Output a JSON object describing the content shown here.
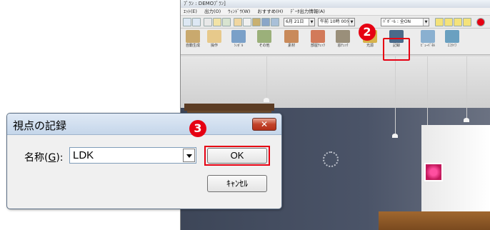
{
  "app": {
    "title": "ﾌﾟﾗﾝ : DEMOﾌﾟﾗﾝ]",
    "menu": [
      "ｴｯﾄ(E)",
      "出力(O)",
      "ｳｨﾝﾄﾞｳ(W)",
      "おすすめ(H)",
      "ﾃﾞｰﾀ出力情報(A)"
    ],
    "date_combo": "6月 21日",
    "time_combo": "午前 10時 00分",
    "view_combo": "ﾊﾟﾎﾞｰﾙ : 全ON",
    "tools": [
      {
        "label": "自動生成",
        "color": "#c9a96e"
      },
      {
        "label": "操作",
        "color": "#e7c98b"
      },
      {
        "label": "ｼﾝﾎﾞﾙ",
        "color": "#7aa0c8"
      },
      {
        "label": "その他",
        "color": "#9bb07a"
      },
      {
        "label": "素材",
        "color": "#c98a5a"
      },
      {
        "label": "部屋ﾁｪｯｸ",
        "color": "#d27a5a"
      },
      {
        "label": "窓ﾁｪｯｸ",
        "color": "#9a8f7a"
      },
      {
        "label": "光源",
        "color": "#d7b34a"
      },
      {
        "label": "記録",
        "color": "#4a6a8a"
      },
      {
        "label": "ﾋﾞｭｰﾊﾟﾈﾙ",
        "color": "#8ab0d0"
      },
      {
        "label": "ｴｺﾗｲﾌ",
        "color": "#6aa0c0"
      }
    ]
  },
  "badges": {
    "step2": "2",
    "step3": "3"
  },
  "dialog": {
    "title": "視点の記録",
    "close_symbol": "✕",
    "name_label_prefix": "名称(",
    "name_label_key": "G",
    "name_label_suffix": "):",
    "name_value": "LDK",
    "ok_label": "OK",
    "cancel_label": "ｷｬﾝｾﾙ"
  },
  "colors": {
    "accent_red": "#e60012"
  }
}
